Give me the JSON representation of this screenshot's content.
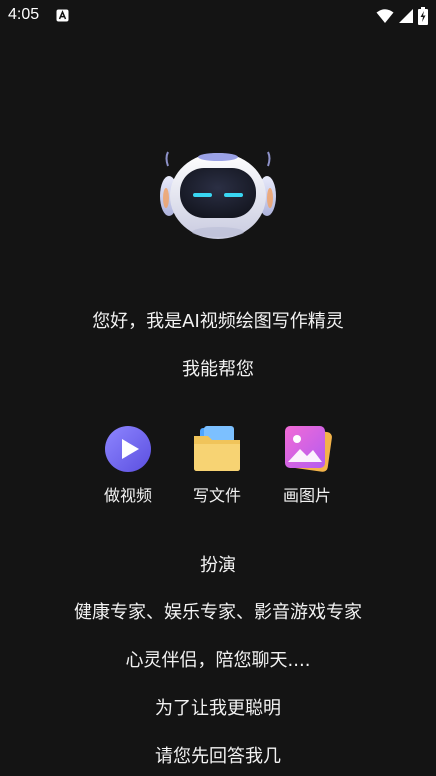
{
  "status_bar": {
    "time": "4:05",
    "icons": [
      "app-notification-icon",
      "wifi-icon",
      "signal-icon",
      "battery-charging-icon"
    ]
  },
  "robot": {
    "icon": "robot-mascot-icon",
    "colors": {
      "body": "#e8e9f2",
      "visor": "#1c1f2e",
      "eyes": "#39d6f2",
      "ears": "#cfd3ec"
    }
  },
  "greeting": "您好，我是AI视频绘图写作精灵",
  "subgreeting": "我能帮您",
  "actions": [
    {
      "label": "做视频",
      "icon": "play-video-icon",
      "color": "#7b6cf2"
    },
    {
      "label": "写文件",
      "icon": "folder-document-icon",
      "color": "#f2b43c"
    },
    {
      "label": "画图片",
      "icon": "picture-gallery-icon",
      "color": "#e15fd0"
    }
  ],
  "lines": {
    "roleplay": "扮演",
    "experts": "健康专家、娱乐专家、影音游戏专家",
    "soulmate": "心灵伴侣，陪您聊天....",
    "smarter": "为了让我更聪明",
    "answer": "请您先回答我几"
  }
}
